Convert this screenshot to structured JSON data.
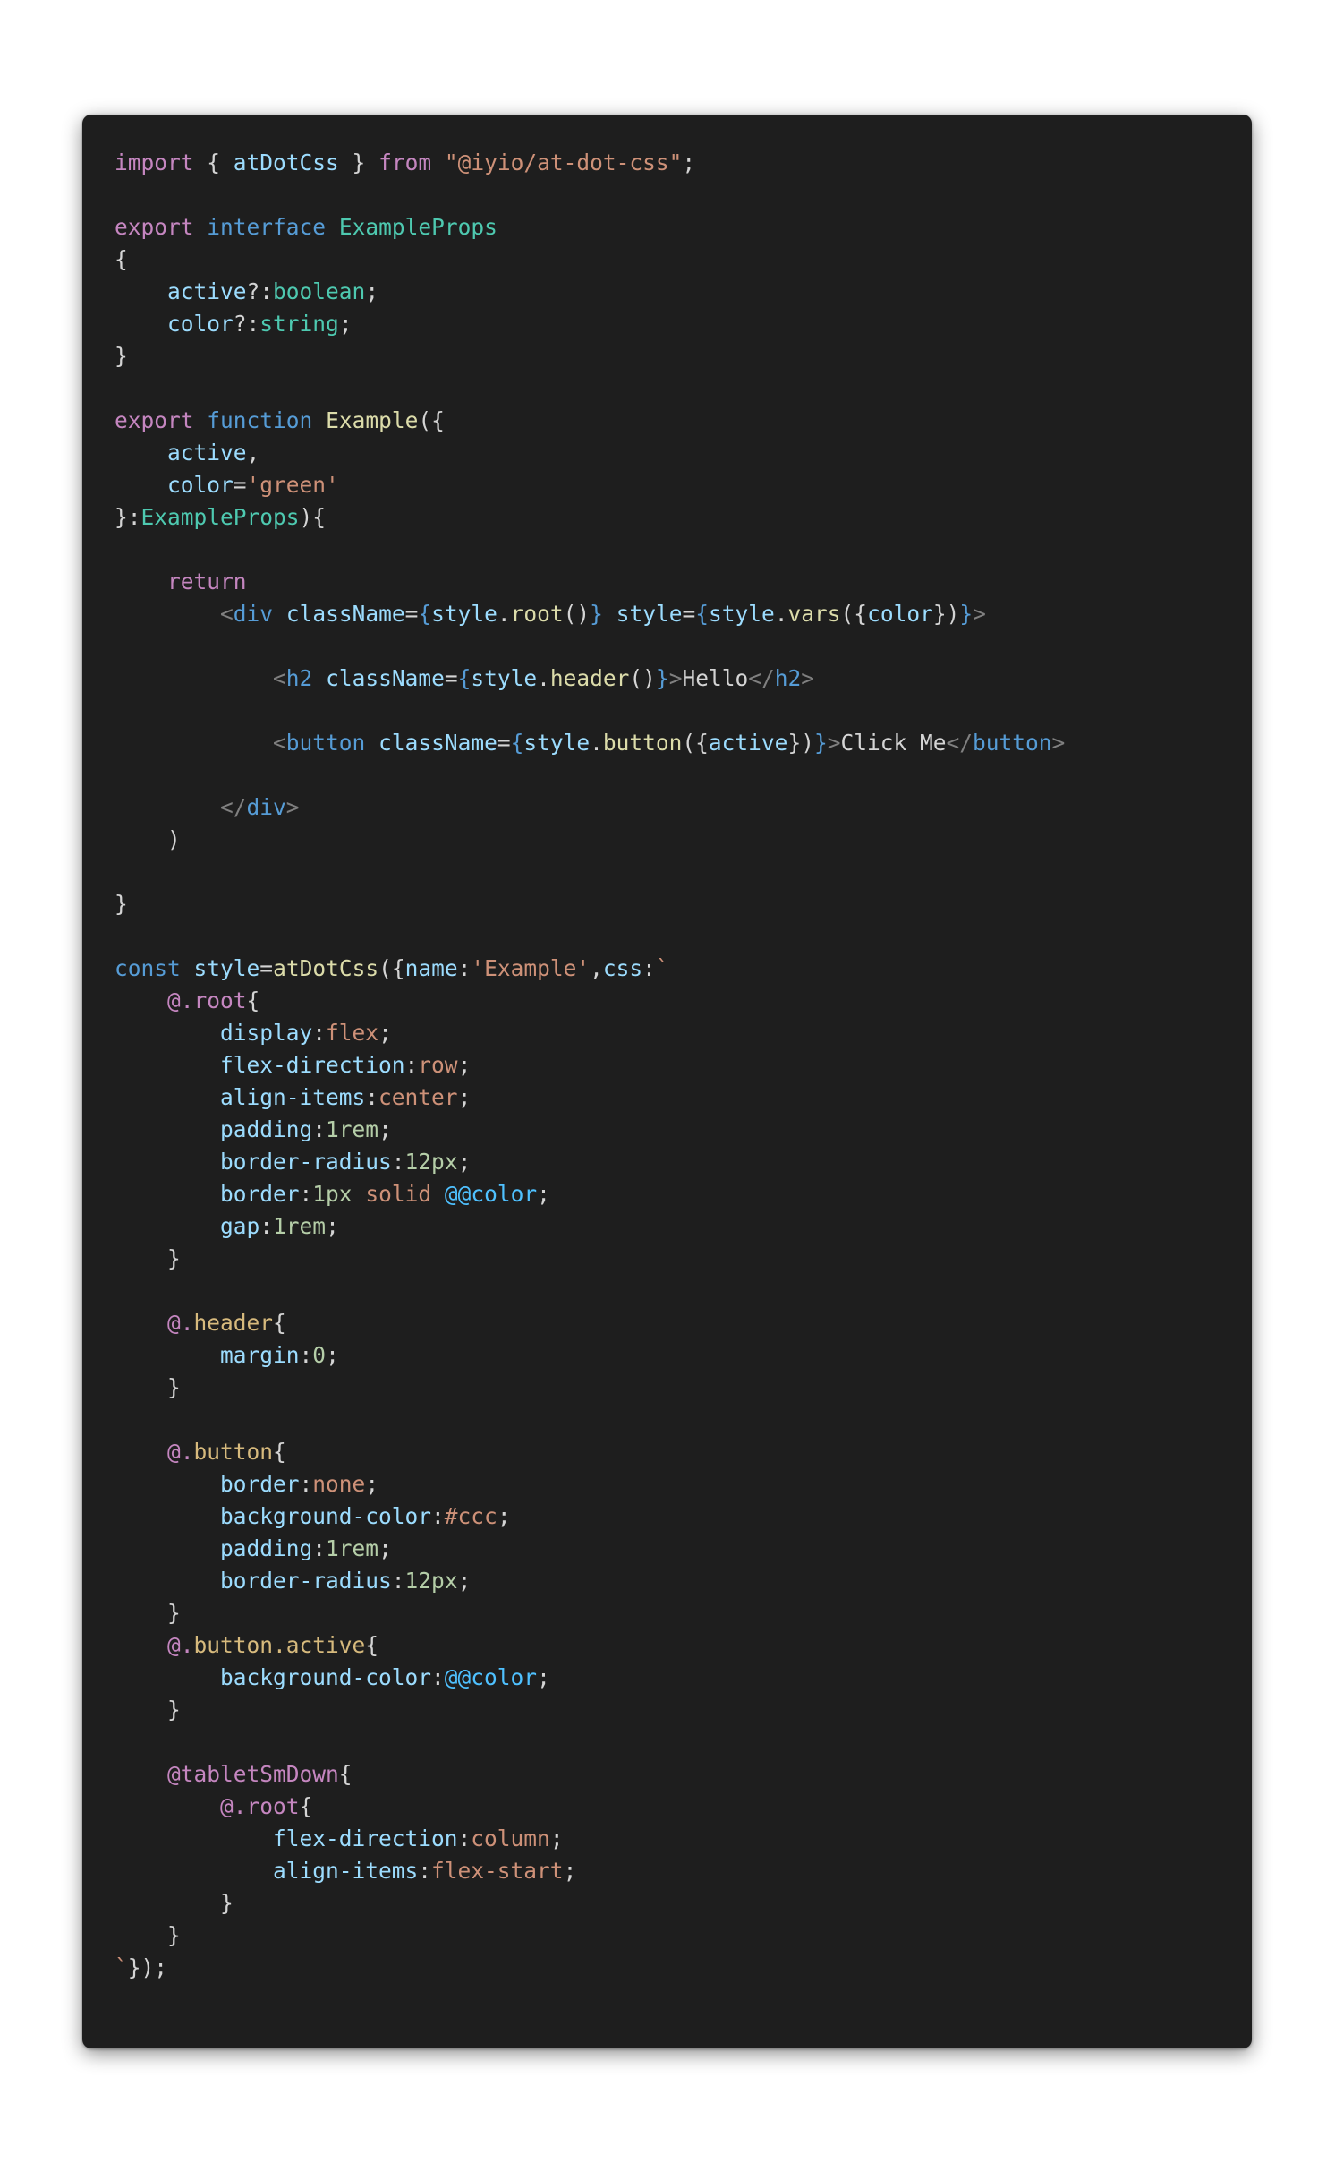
{
  "editor": {
    "theme_colors": {
      "background": "#1e1e1e",
      "plain": "#d4d4d4",
      "keyword": "#c586c0",
      "storage": "#569cd6",
      "type": "#4ec9b0",
      "function": "#dcdcaa",
      "variable": "#9cdcfe",
      "string": "#ce9178",
      "number": "#b5cea8",
      "tag": "#569cd6",
      "punctuation": "#808080",
      "constant": "#4fc1ff"
    },
    "lines": [
      [
        [
          "keyword",
          "import"
        ],
        [
          "plain",
          " { "
        ],
        [
          "var",
          "atDotCss"
        ],
        [
          "plain",
          " } "
        ],
        [
          "keyword",
          "from"
        ],
        [
          "plain",
          " "
        ],
        [
          "string",
          "\"@iyio/at-dot-css\""
        ],
        [
          "plain",
          ";"
        ]
      ],
      [],
      [
        [
          "keyword",
          "export"
        ],
        [
          "plain",
          " "
        ],
        [
          "storage",
          "interface"
        ],
        [
          "plain",
          " "
        ],
        [
          "type",
          "ExampleProps"
        ]
      ],
      [
        [
          "plain",
          "{"
        ]
      ],
      [
        [
          "plain",
          "    "
        ],
        [
          "var",
          "active"
        ],
        [
          "plain",
          "?:"
        ],
        [
          "type",
          "boolean"
        ],
        [
          "plain",
          ";"
        ]
      ],
      [
        [
          "plain",
          "    "
        ],
        [
          "var",
          "color"
        ],
        [
          "plain",
          "?:"
        ],
        [
          "type",
          "string"
        ],
        [
          "plain",
          ";"
        ]
      ],
      [
        [
          "plain",
          "}"
        ]
      ],
      [],
      [
        [
          "keyword",
          "export"
        ],
        [
          "plain",
          " "
        ],
        [
          "storage",
          "function"
        ],
        [
          "plain",
          " "
        ],
        [
          "func",
          "Example"
        ],
        [
          "plain",
          "({"
        ]
      ],
      [
        [
          "plain",
          "    "
        ],
        [
          "var",
          "active"
        ],
        [
          "plain",
          ","
        ]
      ],
      [
        [
          "plain",
          "    "
        ],
        [
          "var",
          "color"
        ],
        [
          "plain",
          "="
        ],
        [
          "string",
          "'green'"
        ]
      ],
      [
        [
          "plain",
          "}:"
        ],
        [
          "type",
          "ExampleProps"
        ],
        [
          "plain",
          "){"
        ]
      ],
      [],
      [
        [
          "plain",
          "    "
        ],
        [
          "keyword",
          "return"
        ]
      ],
      [
        [
          "plain",
          "        "
        ],
        [
          "punct",
          "<"
        ],
        [
          "tag",
          "div"
        ],
        [
          "plain",
          " "
        ],
        [
          "var",
          "className"
        ],
        [
          "plain",
          "="
        ],
        [
          "brace",
          "{"
        ],
        [
          "var",
          "style"
        ],
        [
          "plain",
          "."
        ],
        [
          "func",
          "root"
        ],
        [
          "plain",
          "()"
        ],
        [
          "brace",
          "}"
        ],
        [
          "plain",
          " "
        ],
        [
          "var",
          "style"
        ],
        [
          "plain",
          "="
        ],
        [
          "brace",
          "{"
        ],
        [
          "var",
          "style"
        ],
        [
          "plain",
          "."
        ],
        [
          "func",
          "vars"
        ],
        [
          "plain",
          "({"
        ],
        [
          "var",
          "color"
        ],
        [
          "plain",
          "})"
        ],
        [
          "brace",
          "}"
        ],
        [
          "punct",
          ">"
        ]
      ],
      [],
      [
        [
          "plain",
          "            "
        ],
        [
          "punct",
          "<"
        ],
        [
          "tag",
          "h2"
        ],
        [
          "plain",
          " "
        ],
        [
          "var",
          "className"
        ],
        [
          "plain",
          "="
        ],
        [
          "brace",
          "{"
        ],
        [
          "var",
          "style"
        ],
        [
          "plain",
          "."
        ],
        [
          "func",
          "header"
        ],
        [
          "plain",
          "()"
        ],
        [
          "brace",
          "}"
        ],
        [
          "punct",
          ">"
        ],
        [
          "plain",
          "Hello"
        ],
        [
          "punct",
          "</"
        ],
        [
          "tag",
          "h2"
        ],
        [
          "punct",
          ">"
        ]
      ],
      [],
      [
        [
          "plain",
          "            "
        ],
        [
          "punct",
          "<"
        ],
        [
          "tag",
          "button"
        ],
        [
          "plain",
          " "
        ],
        [
          "var",
          "className"
        ],
        [
          "plain",
          "="
        ],
        [
          "brace",
          "{"
        ],
        [
          "var",
          "style"
        ],
        [
          "plain",
          "."
        ],
        [
          "func",
          "button"
        ],
        [
          "plain",
          "({"
        ],
        [
          "var",
          "active"
        ],
        [
          "plain",
          "})"
        ],
        [
          "brace",
          "}"
        ],
        [
          "punct",
          ">"
        ],
        [
          "plain",
          "Click Me"
        ],
        [
          "punct",
          "</"
        ],
        [
          "tag",
          "button"
        ],
        [
          "punct",
          ">"
        ]
      ],
      [],
      [
        [
          "plain",
          "        "
        ],
        [
          "punct",
          "</"
        ],
        [
          "tag",
          "div"
        ],
        [
          "punct",
          ">"
        ]
      ],
      [
        [
          "plain",
          "    )"
        ]
      ],
      [],
      [
        [
          "plain",
          "}"
        ]
      ],
      [],
      [
        [
          "storage",
          "const"
        ],
        [
          "plain",
          " "
        ],
        [
          "var",
          "style"
        ],
        [
          "plain",
          "="
        ],
        [
          "func",
          "atDotCss"
        ],
        [
          "plain",
          "({"
        ],
        [
          "var",
          "name"
        ],
        [
          "plain",
          ":"
        ],
        [
          "string",
          "'Example'"
        ],
        [
          "plain",
          ","
        ],
        [
          "var",
          "css"
        ],
        [
          "plain",
          ":"
        ],
        [
          "string",
          "`"
        ]
      ],
      [
        [
          "plain",
          "    "
        ],
        [
          "at",
          "@."
        ],
        [
          "at",
          "root"
        ],
        [
          "plain",
          "{"
        ]
      ],
      [
        [
          "plain",
          "        "
        ],
        [
          "var",
          "display"
        ],
        [
          "plain",
          ":"
        ],
        [
          "string",
          "flex"
        ],
        [
          "plain",
          ";"
        ]
      ],
      [
        [
          "plain",
          "        "
        ],
        [
          "var",
          "flex-direction"
        ],
        [
          "plain",
          ":"
        ],
        [
          "string",
          "row"
        ],
        [
          "plain",
          ";"
        ]
      ],
      [
        [
          "plain",
          "        "
        ],
        [
          "var",
          "align-items"
        ],
        [
          "plain",
          ":"
        ],
        [
          "string",
          "center"
        ],
        [
          "plain",
          ";"
        ]
      ],
      [
        [
          "plain",
          "        "
        ],
        [
          "var",
          "padding"
        ],
        [
          "plain",
          ":"
        ],
        [
          "number",
          "1rem"
        ],
        [
          "plain",
          ";"
        ]
      ],
      [
        [
          "plain",
          "        "
        ],
        [
          "var",
          "border-radius"
        ],
        [
          "plain",
          ":"
        ],
        [
          "number",
          "12px"
        ],
        [
          "plain",
          ";"
        ]
      ],
      [
        [
          "plain",
          "        "
        ],
        [
          "var",
          "border"
        ],
        [
          "plain",
          ":"
        ],
        [
          "number",
          "1px"
        ],
        [
          "plain",
          " "
        ],
        [
          "string",
          "solid"
        ],
        [
          "plain",
          " "
        ],
        [
          "const",
          "@@color"
        ],
        [
          "plain",
          ";"
        ]
      ],
      [
        [
          "plain",
          "        "
        ],
        [
          "var",
          "gap"
        ],
        [
          "plain",
          ":"
        ],
        [
          "number",
          "1rem"
        ],
        [
          "plain",
          ";"
        ]
      ],
      [
        [
          "plain",
          "    }"
        ]
      ],
      [],
      [
        [
          "plain",
          "    "
        ],
        [
          "at",
          "@."
        ],
        [
          "sel",
          "header"
        ],
        [
          "plain",
          "{"
        ]
      ],
      [
        [
          "plain",
          "        "
        ],
        [
          "var",
          "margin"
        ],
        [
          "plain",
          ":"
        ],
        [
          "number",
          "0"
        ],
        [
          "plain",
          ";"
        ]
      ],
      [
        [
          "plain",
          "    }"
        ]
      ],
      [],
      [
        [
          "plain",
          "    "
        ],
        [
          "at",
          "@."
        ],
        [
          "sel",
          "button"
        ],
        [
          "plain",
          "{"
        ]
      ],
      [
        [
          "plain",
          "        "
        ],
        [
          "var",
          "border"
        ],
        [
          "plain",
          ":"
        ],
        [
          "string",
          "none"
        ],
        [
          "plain",
          ";"
        ]
      ],
      [
        [
          "plain",
          "        "
        ],
        [
          "var",
          "background-color"
        ],
        [
          "plain",
          ":"
        ],
        [
          "string",
          "#ccc"
        ],
        [
          "plain",
          ";"
        ]
      ],
      [
        [
          "plain",
          "        "
        ],
        [
          "var",
          "padding"
        ],
        [
          "plain",
          ":"
        ],
        [
          "number",
          "1rem"
        ],
        [
          "plain",
          ";"
        ]
      ],
      [
        [
          "plain",
          "        "
        ],
        [
          "var",
          "border-radius"
        ],
        [
          "plain",
          ":"
        ],
        [
          "number",
          "12px"
        ],
        [
          "plain",
          ";"
        ]
      ],
      [
        [
          "plain",
          "    }"
        ]
      ],
      [
        [
          "plain",
          "    "
        ],
        [
          "at",
          "@."
        ],
        [
          "sel",
          "button.active"
        ],
        [
          "plain",
          "{"
        ]
      ],
      [
        [
          "plain",
          "        "
        ],
        [
          "var",
          "background-color"
        ],
        [
          "plain",
          ":"
        ],
        [
          "const",
          "@@color"
        ],
        [
          "plain",
          ";"
        ]
      ],
      [
        [
          "plain",
          "    }"
        ]
      ],
      [],
      [
        [
          "plain",
          "    "
        ],
        [
          "at",
          "@tabletSmDown"
        ],
        [
          "plain",
          "{"
        ]
      ],
      [
        [
          "plain",
          "        "
        ],
        [
          "at",
          "@."
        ],
        [
          "at",
          "root"
        ],
        [
          "plain",
          "{"
        ]
      ],
      [
        [
          "plain",
          "            "
        ],
        [
          "var",
          "flex-direction"
        ],
        [
          "plain",
          ":"
        ],
        [
          "string",
          "column"
        ],
        [
          "plain",
          ";"
        ]
      ],
      [
        [
          "plain",
          "            "
        ],
        [
          "var",
          "align-items"
        ],
        [
          "plain",
          ":"
        ],
        [
          "string",
          "flex-start"
        ],
        [
          "plain",
          ";"
        ]
      ],
      [
        [
          "plain",
          "        }"
        ]
      ],
      [
        [
          "plain",
          "    }"
        ]
      ],
      [
        [
          "string",
          "`"
        ],
        [
          "plain",
          "});"
        ]
      ]
    ]
  }
}
